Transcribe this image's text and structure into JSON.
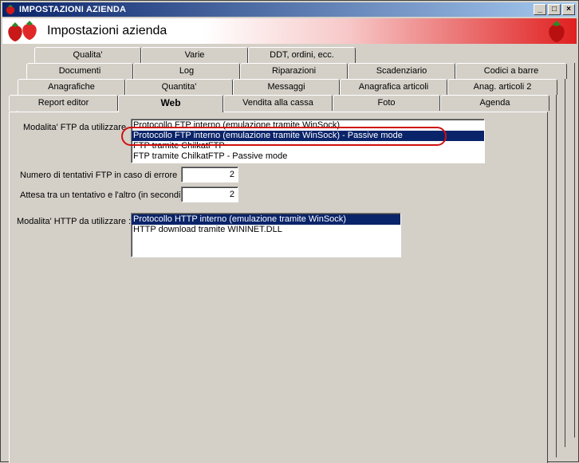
{
  "window": {
    "title": "IMPOSTAZIONI AZIENDA",
    "header_title": "Impostazioni azienda",
    "buttons": [
      "_",
      "□",
      "×"
    ]
  },
  "tabs": {
    "row1": [
      "Qualita'",
      "Varie",
      "DDT, ordini, ecc."
    ],
    "row2": [
      "Documenti",
      "Log",
      "Riparazioni",
      "Scadenziario",
      "Codici a barre"
    ],
    "row3": [
      "Anagrafiche",
      "Quantita'",
      "Messaggi",
      "Anagrafica articoli",
      "Anag. articoli 2"
    ],
    "row4": [
      "Report editor",
      "Web",
      "Vendita alla cassa",
      "Foto",
      "Agenda"
    ],
    "active": "Web"
  },
  "web": {
    "ftp_label": "Modalita' FTP da utilizzare",
    "ftp_options": [
      "Protocollo FTP interno (emulazione tramite WinSock)",
      "Protocollo FTP interno (emulazione tramite WinSock) - Passive mode",
      "FTP tramite ChilkatFTP",
      "FTP tramite ChilkatFTP - Passive mode"
    ],
    "ftp_selected_index": 1,
    "retries_label": "Numero di tentativi FTP in caso di errore",
    "retries_value": "2",
    "wait_label": "Attesa tra un tentativo e l'altro (in secondi)",
    "wait_value": "2",
    "http_label": "Modalita' HTTP da utilizzare :",
    "http_options": [
      "Protocollo HTTP interno (emulazione tramite WinSock)",
      "HTTP download tramite WININET.DLL"
    ],
    "http_selected_index": 0
  },
  "colors": {
    "selection": "#0a246a",
    "highlight_oval": "#d01010"
  }
}
